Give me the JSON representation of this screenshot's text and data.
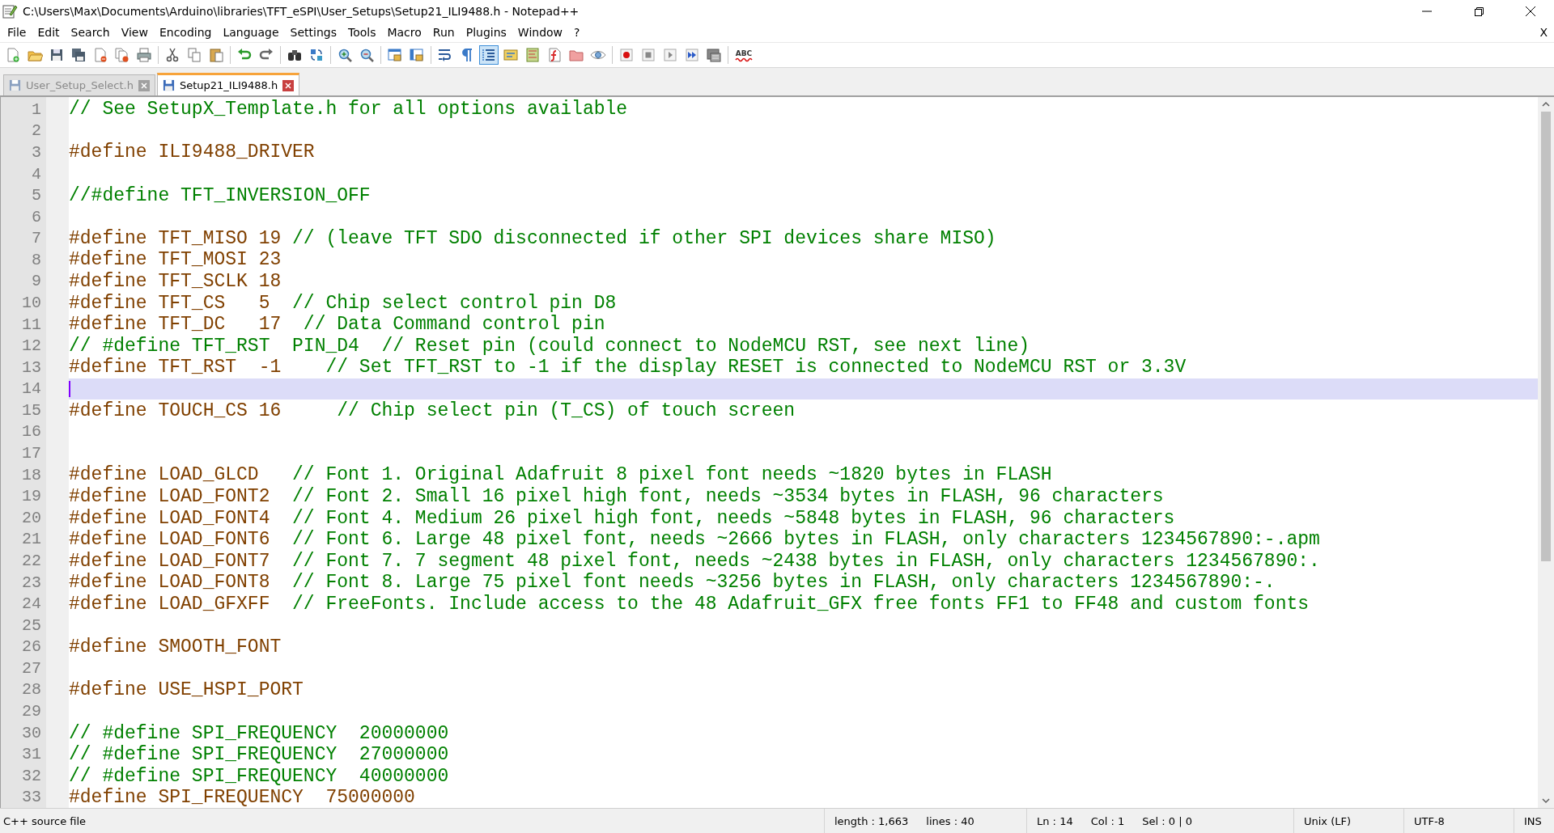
{
  "window": {
    "title": "C:\\Users\\Max\\Documents\\Arduino\\libraries\\TFT_eSPI\\User_Setups\\Setup21_ILI9488.h - Notepad++"
  },
  "menu": {
    "items": [
      "File",
      "Edit",
      "Search",
      "View",
      "Encoding",
      "Language",
      "Settings",
      "Tools",
      "Macro",
      "Run",
      "Plugins",
      "Window",
      "?"
    ],
    "close_label": "X"
  },
  "toolbar": [
    {
      "kind": "new",
      "pressed": false
    },
    {
      "kind": "open",
      "pressed": false
    },
    {
      "kind": "save",
      "pressed": false
    },
    {
      "kind": "saveall",
      "pressed": false
    },
    {
      "kind": "close",
      "pressed": false
    },
    {
      "kind": "closeall",
      "pressed": false
    },
    {
      "kind": "print",
      "pressed": false
    },
    {
      "kind": "sep"
    },
    {
      "kind": "cut",
      "pressed": false
    },
    {
      "kind": "copy",
      "pressed": false
    },
    {
      "kind": "paste",
      "pressed": false
    },
    {
      "kind": "sep"
    },
    {
      "kind": "undo",
      "pressed": false
    },
    {
      "kind": "redo",
      "pressed": false
    },
    {
      "kind": "sep"
    },
    {
      "kind": "find",
      "pressed": false
    },
    {
      "kind": "replace",
      "pressed": false
    },
    {
      "kind": "sep"
    },
    {
      "kind": "zoomin",
      "pressed": false
    },
    {
      "kind": "zoomout",
      "pressed": false
    },
    {
      "kind": "sep"
    },
    {
      "kind": "syncv",
      "pressed": false
    },
    {
      "kind": "synch",
      "pressed": false
    },
    {
      "kind": "sep"
    },
    {
      "kind": "wrap",
      "pressed": false
    },
    {
      "kind": "pilcrow",
      "pressed": false
    },
    {
      "kind": "indent",
      "pressed": true
    },
    {
      "kind": "udl",
      "pressed": false
    },
    {
      "kind": "map",
      "pressed": false
    },
    {
      "kind": "func",
      "pressed": false
    },
    {
      "kind": "folder",
      "pressed": false
    },
    {
      "kind": "eye",
      "pressed": false
    },
    {
      "kind": "sep"
    },
    {
      "kind": "record",
      "pressed": false
    },
    {
      "kind": "stop",
      "pressed": false
    },
    {
      "kind": "play",
      "pressed": false
    },
    {
      "kind": "playmulti",
      "pressed": false
    },
    {
      "kind": "savemacro",
      "pressed": false
    },
    {
      "kind": "sep"
    },
    {
      "kind": "spell",
      "pressed": false,
      "label": "ABC"
    }
  ],
  "tabs": [
    {
      "label": "User_Setup_Select.h",
      "selected": false
    },
    {
      "label": "Setup21_ILI9488.h",
      "selected": true
    }
  ],
  "editor": {
    "lines": [
      {
        "number": "1",
        "comment": "// See SetupX_Template.h for all options available",
        "current": false
      },
      {
        "number": "2",
        "current": false
      },
      {
        "number": "3",
        "code": "#define ILI9488_DRIVER",
        "current": false
      },
      {
        "number": "4",
        "current": false
      },
      {
        "number": "5",
        "comment": "//#define TFT_INVERSION_OFF",
        "current": false
      },
      {
        "number": "6",
        "current": false
      },
      {
        "number": "7",
        "code": "#define TFT_MISO 19 ",
        "comment": "// (leave TFT SDO disconnected if other SPI devices share MISO)",
        "current": false
      },
      {
        "number": "8",
        "code": "#define TFT_MOSI 23",
        "current": false
      },
      {
        "number": "9",
        "code": "#define TFT_SCLK 18",
        "current": false
      },
      {
        "number": "10",
        "code": "#define TFT_CS   5  ",
        "comment": "// Chip select control pin D8",
        "current": false
      },
      {
        "number": "11",
        "code": "#define TFT_DC   17  ",
        "comment": "// Data Command control pin",
        "current": false
      },
      {
        "number": "12",
        "comment": "// #define TFT_RST  PIN_D4  // Reset pin (could connect to NodeMCU RST, see next line)",
        "current": false
      },
      {
        "number": "13",
        "code": "#define TFT_RST  -1    ",
        "comment": "// Set TFT_RST to -1 if the display RESET is connected to NodeMCU RST or 3.3V",
        "current": false
      },
      {
        "number": "14",
        "current": true
      },
      {
        "number": "15",
        "code": "#define TOUCH_CS 16     ",
        "comment": "// Chip select pin (T_CS) of touch screen",
        "current": false
      },
      {
        "number": "16",
        "current": false
      },
      {
        "number": "17",
        "current": false
      },
      {
        "number": "18",
        "code": "#define LOAD_GLCD   ",
        "comment": "// Font 1. Original Adafruit 8 pixel font needs ~1820 bytes in FLASH",
        "current": false
      },
      {
        "number": "19",
        "code": "#define LOAD_FONT2  ",
        "comment": "// Font 2. Small 16 pixel high font, needs ~3534 bytes in FLASH, 96 characters",
        "current": false
      },
      {
        "number": "20",
        "code": "#define LOAD_FONT4  ",
        "comment": "// Font 4. Medium 26 pixel high font, needs ~5848 bytes in FLASH, 96 characters",
        "current": false
      },
      {
        "number": "21",
        "code": "#define LOAD_FONT6  ",
        "comment": "// Font 6. Large 48 pixel font, needs ~2666 bytes in FLASH, only characters 1234567890:-.apm",
        "current": false
      },
      {
        "number": "22",
        "code": "#define LOAD_FONT7  ",
        "comment": "// Font 7. 7 segment 48 pixel font, needs ~2438 bytes in FLASH, only characters 1234567890:.",
        "current": false
      },
      {
        "number": "23",
        "code": "#define LOAD_FONT8  ",
        "comment": "// Font 8. Large 75 pixel font needs ~3256 bytes in FLASH, only characters 1234567890:-.",
        "current": false
      },
      {
        "number": "24",
        "code": "#define LOAD_GFXFF  ",
        "comment": "// FreeFonts. Include access to the 48 Adafruit_GFX free fonts FF1 to FF48 and custom fonts",
        "current": false
      },
      {
        "number": "25",
        "current": false
      },
      {
        "number": "26",
        "code": "#define SMOOTH_FONT",
        "current": false
      },
      {
        "number": "27",
        "current": false
      },
      {
        "number": "28",
        "code": "#define USE_HSPI_PORT",
        "current": false
      },
      {
        "number": "29",
        "current": false
      },
      {
        "number": "30",
        "comment": "// #define SPI_FREQUENCY  20000000",
        "current": false
      },
      {
        "number": "31",
        "comment": "// #define SPI_FREQUENCY  27000000",
        "current": false
      },
      {
        "number": "32",
        "comment": "// #define SPI_FREQUENCY  40000000",
        "current": false
      },
      {
        "number": "33",
        "code": "#define SPI_FREQUENCY  75000000",
        "current": false
      }
    ]
  },
  "status_bar": {
    "file_type": "C++ source file",
    "length": "length : 1,663",
    "lines": "lines : 40",
    "ln": "Ln : 14",
    "col": "Col : 1",
    "sel": "Sel : 0 | 0",
    "eol": "Unix (LF)",
    "encoding": "UTF-8",
    "mode": "INS"
  }
}
